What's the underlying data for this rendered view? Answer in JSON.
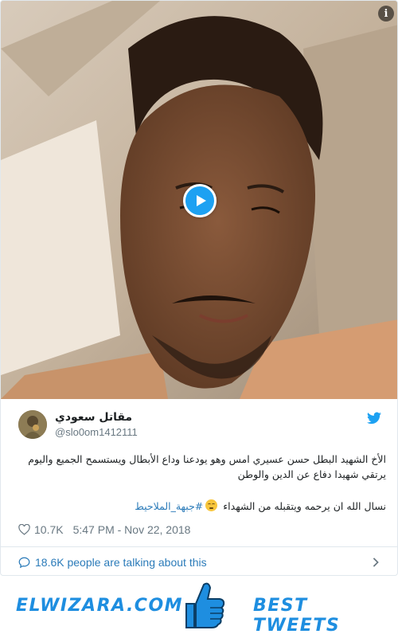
{
  "media": {
    "play_icon": "play-icon",
    "info_label": "i"
  },
  "author": {
    "name": "مقاتل سعودي",
    "handle": "@slo0om1412111",
    "platform_icon": "twitter-bird-icon"
  },
  "tweet": {
    "line1": "الأخ الشهيد البطل حسن عسيري امس وهو يودعنا وداع الأبطال ويستسمح الجميع واليوم يرتقي شهيدا دفاع عن الدين والوطن",
    "line2_text": "نسال الله ان يرحمه ويتقبله من الشهداء",
    "line2_hashtag": "#جبهة_الملاحيط",
    "emoji": "pensive-face"
  },
  "stats": {
    "likes": "10.7K",
    "timestamp": "5:47 PM - Nov 22, 2018"
  },
  "talking": {
    "label": "18.6K people are talking about this"
  },
  "banner": {
    "brand": "ELWIZARA.COM",
    "tagline": "BEST TWEETS",
    "accent": "#1e8ee0"
  },
  "colors": {
    "twitter_blue": "#1da1f2",
    "link_blue": "#2b7bb9",
    "muted": "#697882"
  }
}
